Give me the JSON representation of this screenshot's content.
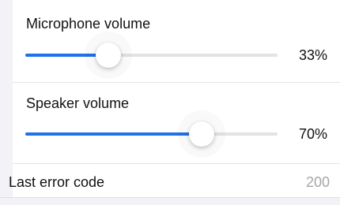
{
  "microphone": {
    "label": "Microphone volume",
    "value_text": "33%",
    "level": 0.33
  },
  "speaker": {
    "label": "Speaker volume",
    "value_text": "70%",
    "level": 0.7
  },
  "last_error": {
    "label": "Last error code",
    "value": "200"
  },
  "colors": {
    "accent": "#1f72e8",
    "track": "#e3e3e3",
    "secondary_text": "#a6a6a6"
  }
}
